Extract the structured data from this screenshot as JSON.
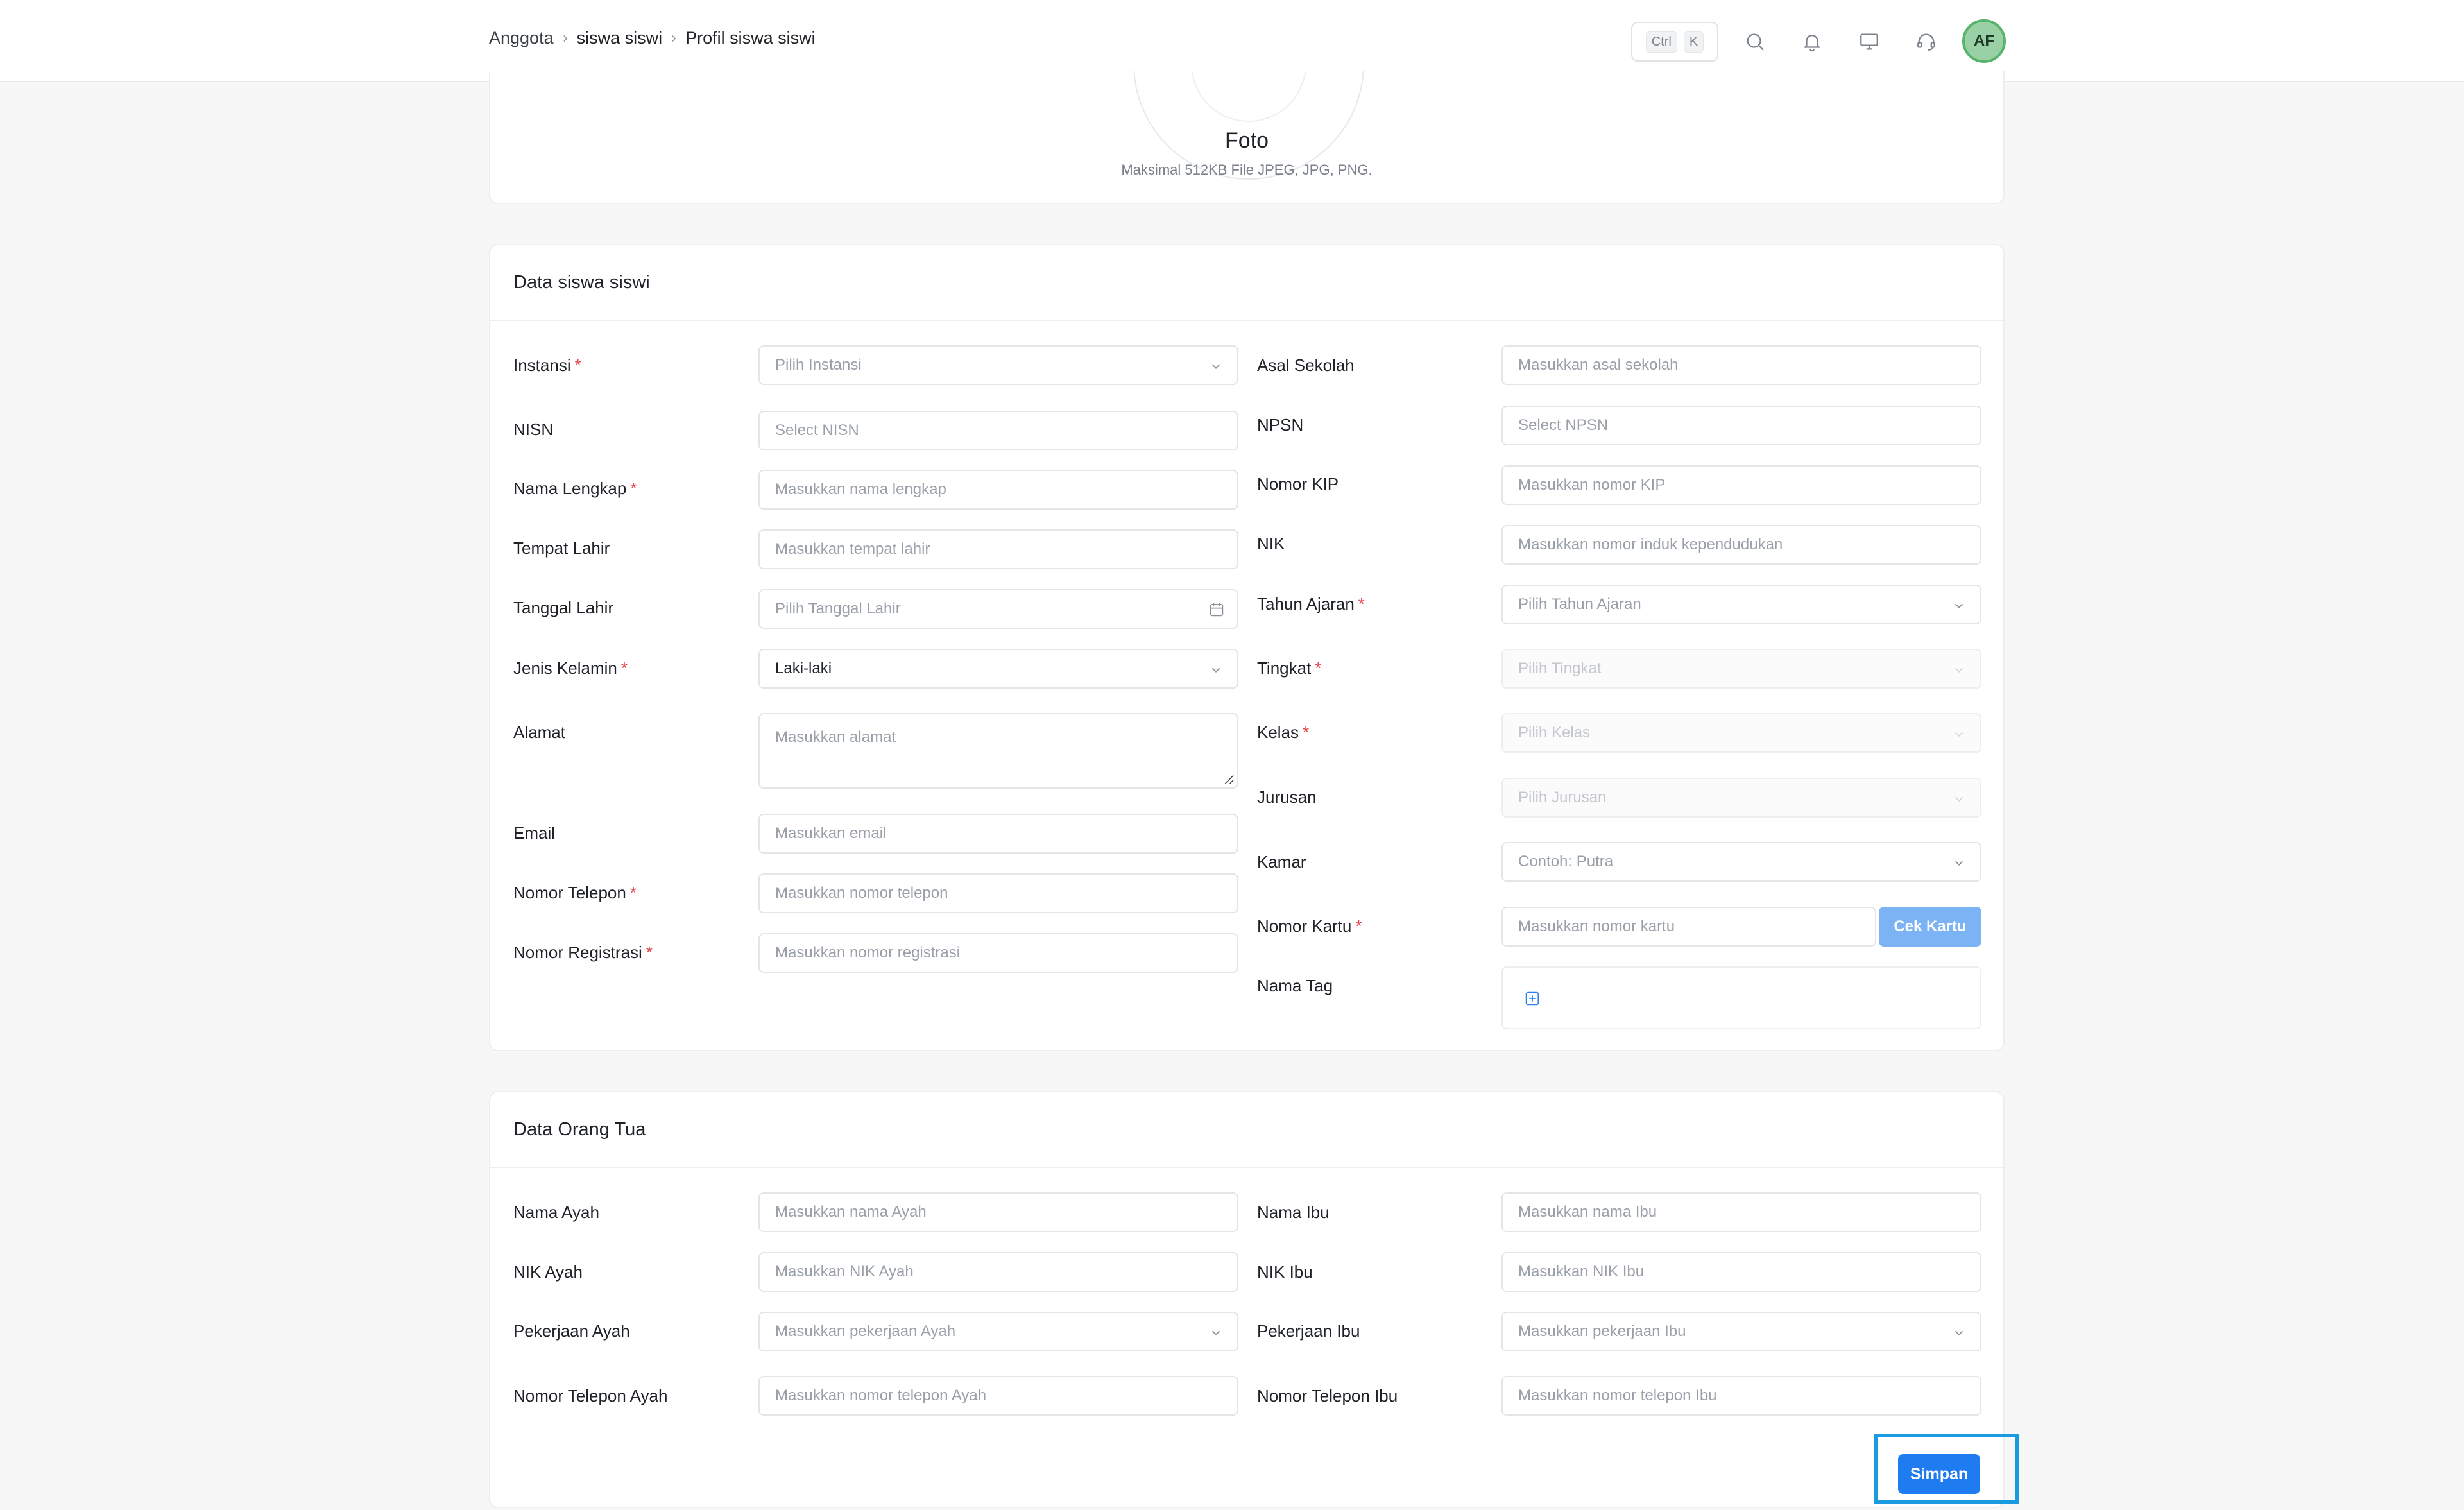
{
  "breadcrumb": {
    "items": [
      "Anggota",
      "siswa siswi",
      "Profil siswa siswi"
    ]
  },
  "topbar": {
    "shortcut_keys": [
      "Ctrl",
      "K"
    ],
    "icons": [
      "search-icon",
      "bell-icon",
      "monitor-icon",
      "headset-icon"
    ],
    "avatar_initials": "AF"
  },
  "photo": {
    "title": "Foto",
    "hint": "Maksimal 512KB File JPEG, JPG, PNG."
  },
  "student": {
    "title": "Data siswa siswi",
    "left": [
      {
        "label": "Instansi",
        "required": "*",
        "placeholder": "Pilih Instansi"
      },
      {
        "label": "NISN",
        "placeholder": "Select NISN"
      },
      {
        "label": "Nama Lengkap",
        "required": "*",
        "placeholder": "Masukkan nama lengkap"
      },
      {
        "label": "Tempat Lahir",
        "placeholder": "Masukkan tempat lahir"
      },
      {
        "label": "Tanggal Lahir",
        "placeholder": "Pilih Tanggal Lahir"
      },
      {
        "label": "Jenis Kelamin",
        "required": "*",
        "value": "Laki-laki"
      },
      {
        "label": "Alamat",
        "placeholder": "Masukkan alamat"
      },
      {
        "label": "Email",
        "placeholder": "Masukkan email"
      },
      {
        "label": "Nomor Telepon",
        "required": "*",
        "placeholder": "Masukkan nomor telepon"
      },
      {
        "label": "Nomor Registrasi",
        "required": "*",
        "placeholder": "Masukkan nomor registrasi"
      }
    ],
    "right": [
      {
        "label": "Asal Sekolah",
        "placeholder": "Masukkan asal sekolah"
      },
      {
        "label": "NPSN",
        "placeholder": "Select NPSN"
      },
      {
        "label": "Nomor KIP",
        "placeholder": "Masukkan nomor KIP"
      },
      {
        "label": "NIK",
        "placeholder": "Masukkan nomor induk kependudukan"
      },
      {
        "label": "Tahun Ajaran",
        "required": "*",
        "placeholder": "Pilih Tahun Ajaran"
      },
      {
        "label": "Tingkat",
        "required": "*",
        "placeholder": "Pilih Tingkat"
      },
      {
        "label": "Kelas",
        "required": "*",
        "placeholder": "Pilih Kelas"
      },
      {
        "label": "Jurusan",
        "placeholder": "Pilih Jurusan"
      },
      {
        "label": "Kamar",
        "placeholder": "Contoh: Putra"
      },
      {
        "label": "Nomor Kartu",
        "required": "*",
        "placeholder": "Masukkan nomor kartu",
        "button": "Cek Kartu"
      },
      {
        "label": "Nama Tag"
      }
    ]
  },
  "parent": {
    "title": "Data Orang Tua",
    "left": [
      {
        "label": "Nama Ayah",
        "placeholder": "Masukkan nama Ayah"
      },
      {
        "label": "NIK Ayah",
        "placeholder": "Masukkan NIK Ayah"
      },
      {
        "label": "Pekerjaan Ayah",
        "placeholder": "Masukkan pekerjaan Ayah"
      },
      {
        "label": "Nomor Telepon Ayah",
        "placeholder": "Masukkan nomor telepon Ayah"
      }
    ],
    "right": [
      {
        "label": "Nama Ibu",
        "placeholder": "Masukkan nama Ibu"
      },
      {
        "label": "NIK Ibu",
        "placeholder": "Masukkan NIK Ibu"
      },
      {
        "label": "Pekerjaan Ibu",
        "placeholder": "Masukkan pekerjaan Ibu"
      },
      {
        "label": "Nomor Telepon Ibu",
        "placeholder": "Masukkan nomor telepon Ibu"
      }
    ],
    "save_label": "Simpan"
  },
  "colors": {
    "primary": "#1f7cf0",
    "required": "#e5484d",
    "highlight": "#1a9be0"
  }
}
